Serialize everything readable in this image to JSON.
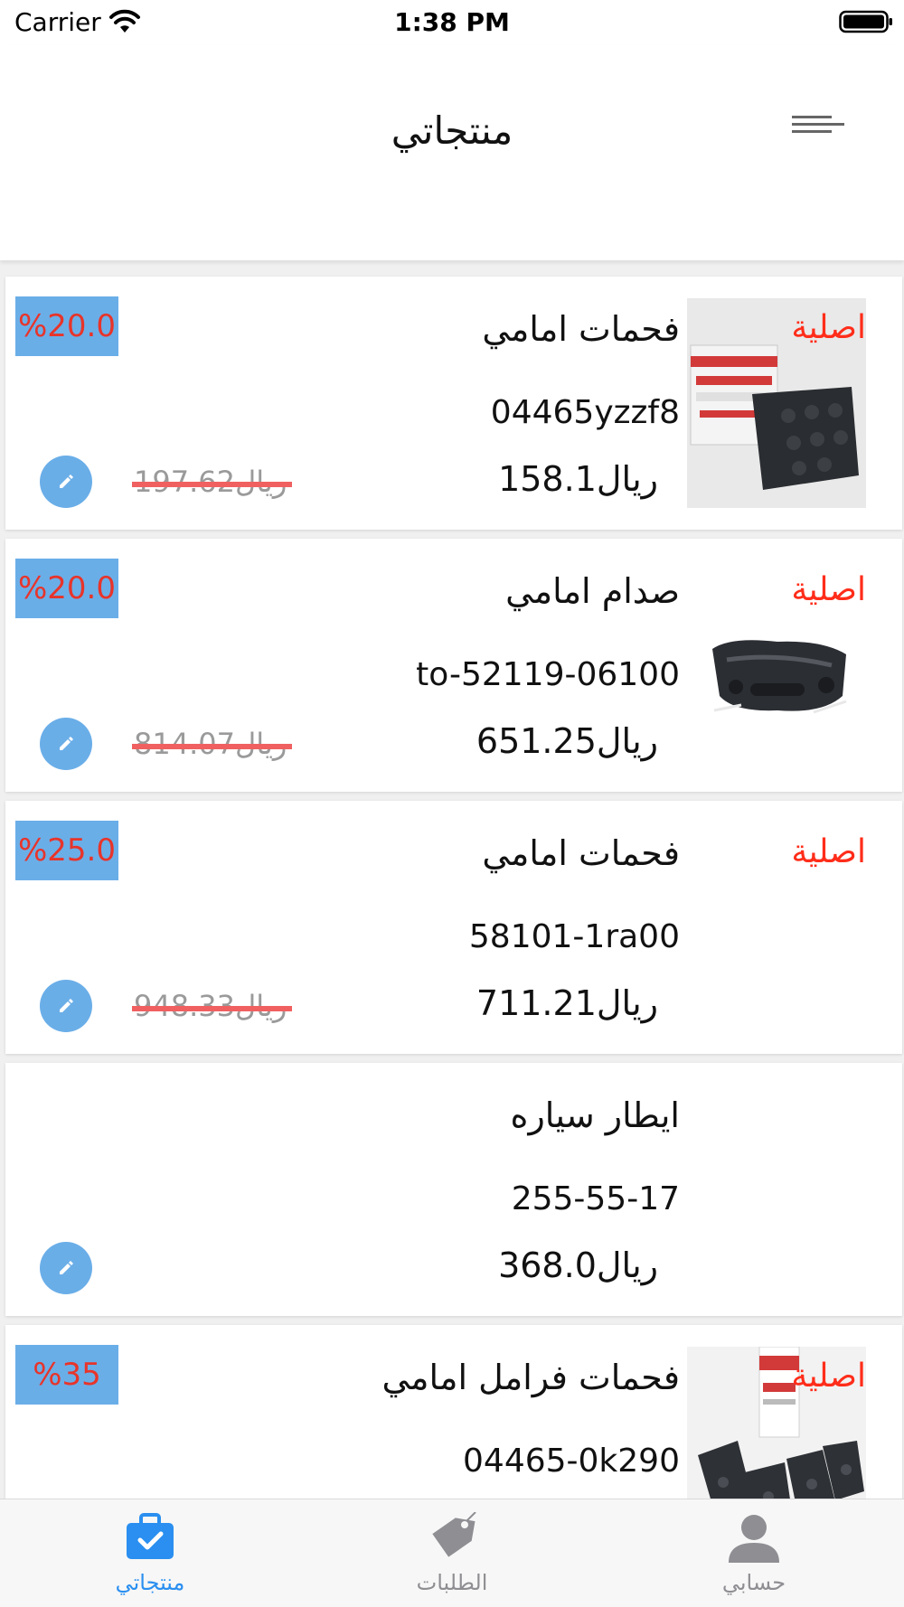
{
  "status_bar": {
    "carrier": "Carrier",
    "time": "1:38 PM"
  },
  "header": {
    "title": "منتجاتي"
  },
  "products": [
    {
      "condition": "اصلية",
      "name": "فحمات امامي",
      "part_number": "04465yzzf8",
      "price": "158.1ريال",
      "old_price": "197.62ريال",
      "discount": "%20.0",
      "image": "brake-pads-box"
    },
    {
      "condition": "اصلية",
      "name": "صدام امامي",
      "part_number": "to-52119-06100",
      "price": "651.25ريال",
      "old_price": "814.07ريال",
      "discount": "%20.0",
      "image": "front-bumper"
    },
    {
      "condition": "اصلية",
      "name": "فحمات امامي",
      "part_number": "58101-1ra00",
      "price": "711.21ريال",
      "old_price": "948.33ريال",
      "discount": "%25.0",
      "image": ""
    },
    {
      "condition": "",
      "name": "ايطار سياره",
      "part_number": "255-55-17",
      "price": "368.0ريال",
      "old_price": "",
      "discount": "",
      "image": ""
    },
    {
      "condition": "اصلية",
      "name": "فحمات فرامل امامي",
      "part_number": "04465-0k290",
      "price": "",
      "old_price": "",
      "discount": "%35",
      "image": "brake-pads-set"
    }
  ],
  "tab_bar": {
    "tabs": [
      {
        "label": "منتجاتي",
        "icon": "briefcase-check-icon",
        "active": true
      },
      {
        "label": "الطلبات",
        "icon": "price-tag-icon",
        "active": false
      },
      {
        "label": "حسابي",
        "icon": "person-icon",
        "active": false
      }
    ]
  },
  "colors": {
    "accent": "#2a8ff0",
    "badge": "#6aaee8",
    "discount_text": "#e8342a",
    "original_label": "#ff2d1a",
    "strike": "#f06060"
  }
}
